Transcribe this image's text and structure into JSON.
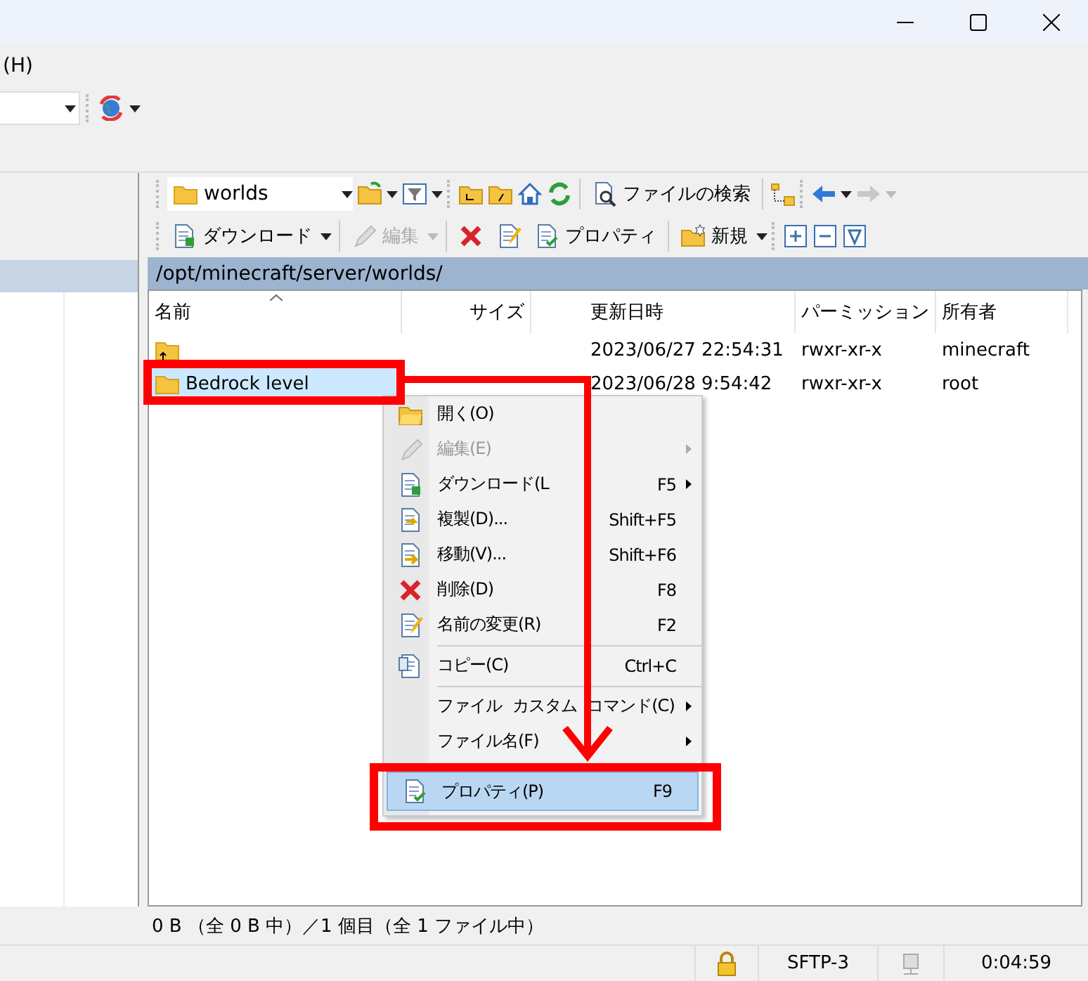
{
  "menu_bar": {
    "items": [
      "(H)"
    ]
  },
  "remote_panel": {
    "location": "worlds",
    "find_button": "ファイルの検索",
    "actions": [
      {
        "kind": "dropdown",
        "label": "ダウンロード",
        "disabled": false
      },
      {
        "kind": "dropdown",
        "label": "編集",
        "disabled": true
      },
      {
        "kind": "icon",
        "disabled": false
      },
      {
        "kind": "icon",
        "disabled": false
      },
      {
        "kind": "button",
        "label": "プロパティ",
        "disabled": false
      },
      {
        "kind": "dropdown",
        "label": "新規",
        "disabled": false
      }
    ],
    "path": "/opt/minecraft/server/worlds/",
    "columns": [
      "名前",
      "サイズ",
      "更新日時",
      "パーミッション",
      "所有者"
    ],
    "rows": [
      {
        "kind": "parent",
        "name": "",
        "size": "",
        "modified": "2023/06/27 22:54:31",
        "permissions": "rwxr-xr-x",
        "owner": "minecraft",
        "selected": false
      },
      {
        "kind": "folder",
        "name": "Bedrock level",
        "size": "",
        "modified": "2023/06/28 9:54:42",
        "permissions": "rwxr-xr-x",
        "owner": "root",
        "selected": true
      }
    ]
  },
  "context_menu": {
    "items": [
      {
        "kind": "item",
        "label": "開く(O)",
        "disabled": false,
        "submenu": false,
        "selected": false
      },
      {
        "kind": "item",
        "label": "編集(E)",
        "disabled": true,
        "submenu": true,
        "selected": false
      },
      {
        "kind": "item",
        "label": "ダウンロード(L",
        "shortcut": "F5",
        "disabled": false,
        "submenu": true,
        "selected": false
      },
      {
        "kind": "item",
        "label": "複製(D)...",
        "shortcut": "Shift+F5",
        "disabled": false,
        "submenu": false,
        "selected": false
      },
      {
        "kind": "item",
        "label": "移動(V)...",
        "shortcut": "Shift+F6",
        "disabled": false,
        "submenu": false,
        "selected": false
      },
      {
        "kind": "item",
        "label": "削除(D)",
        "shortcut": "F8",
        "disabled": false,
        "submenu": false,
        "selected": false
      },
      {
        "kind": "item",
        "label": "名前の変更(R)",
        "shortcut": "F2",
        "disabled": false,
        "submenu": false,
        "selected": false
      },
      {
        "kind": "separator"
      },
      {
        "kind": "item",
        "label": "コピー(C)",
        "shortcut": "Ctrl+C",
        "disabled": false,
        "submenu": false,
        "selected": false
      },
      {
        "kind": "separator"
      },
      {
        "kind": "item",
        "label": "ファイル カスタム コマンド(C)",
        "disabled": false,
        "submenu": true,
        "selected": false
      },
      {
        "kind": "item",
        "label": "ファイル名(F)",
        "disabled": false,
        "submenu": true,
        "selected": false
      },
      {
        "kind": "item",
        "label": "プロパティ(P)",
        "shortcut": "F9",
        "disabled": false,
        "submenu": false,
        "selected": true
      }
    ]
  },
  "status_text": "0 B （全 0 B 中）／1 個目（全 1 ファイル中）",
  "status_bar": {
    "protocol": "SFTP-3",
    "time": "0:04:59"
  }
}
